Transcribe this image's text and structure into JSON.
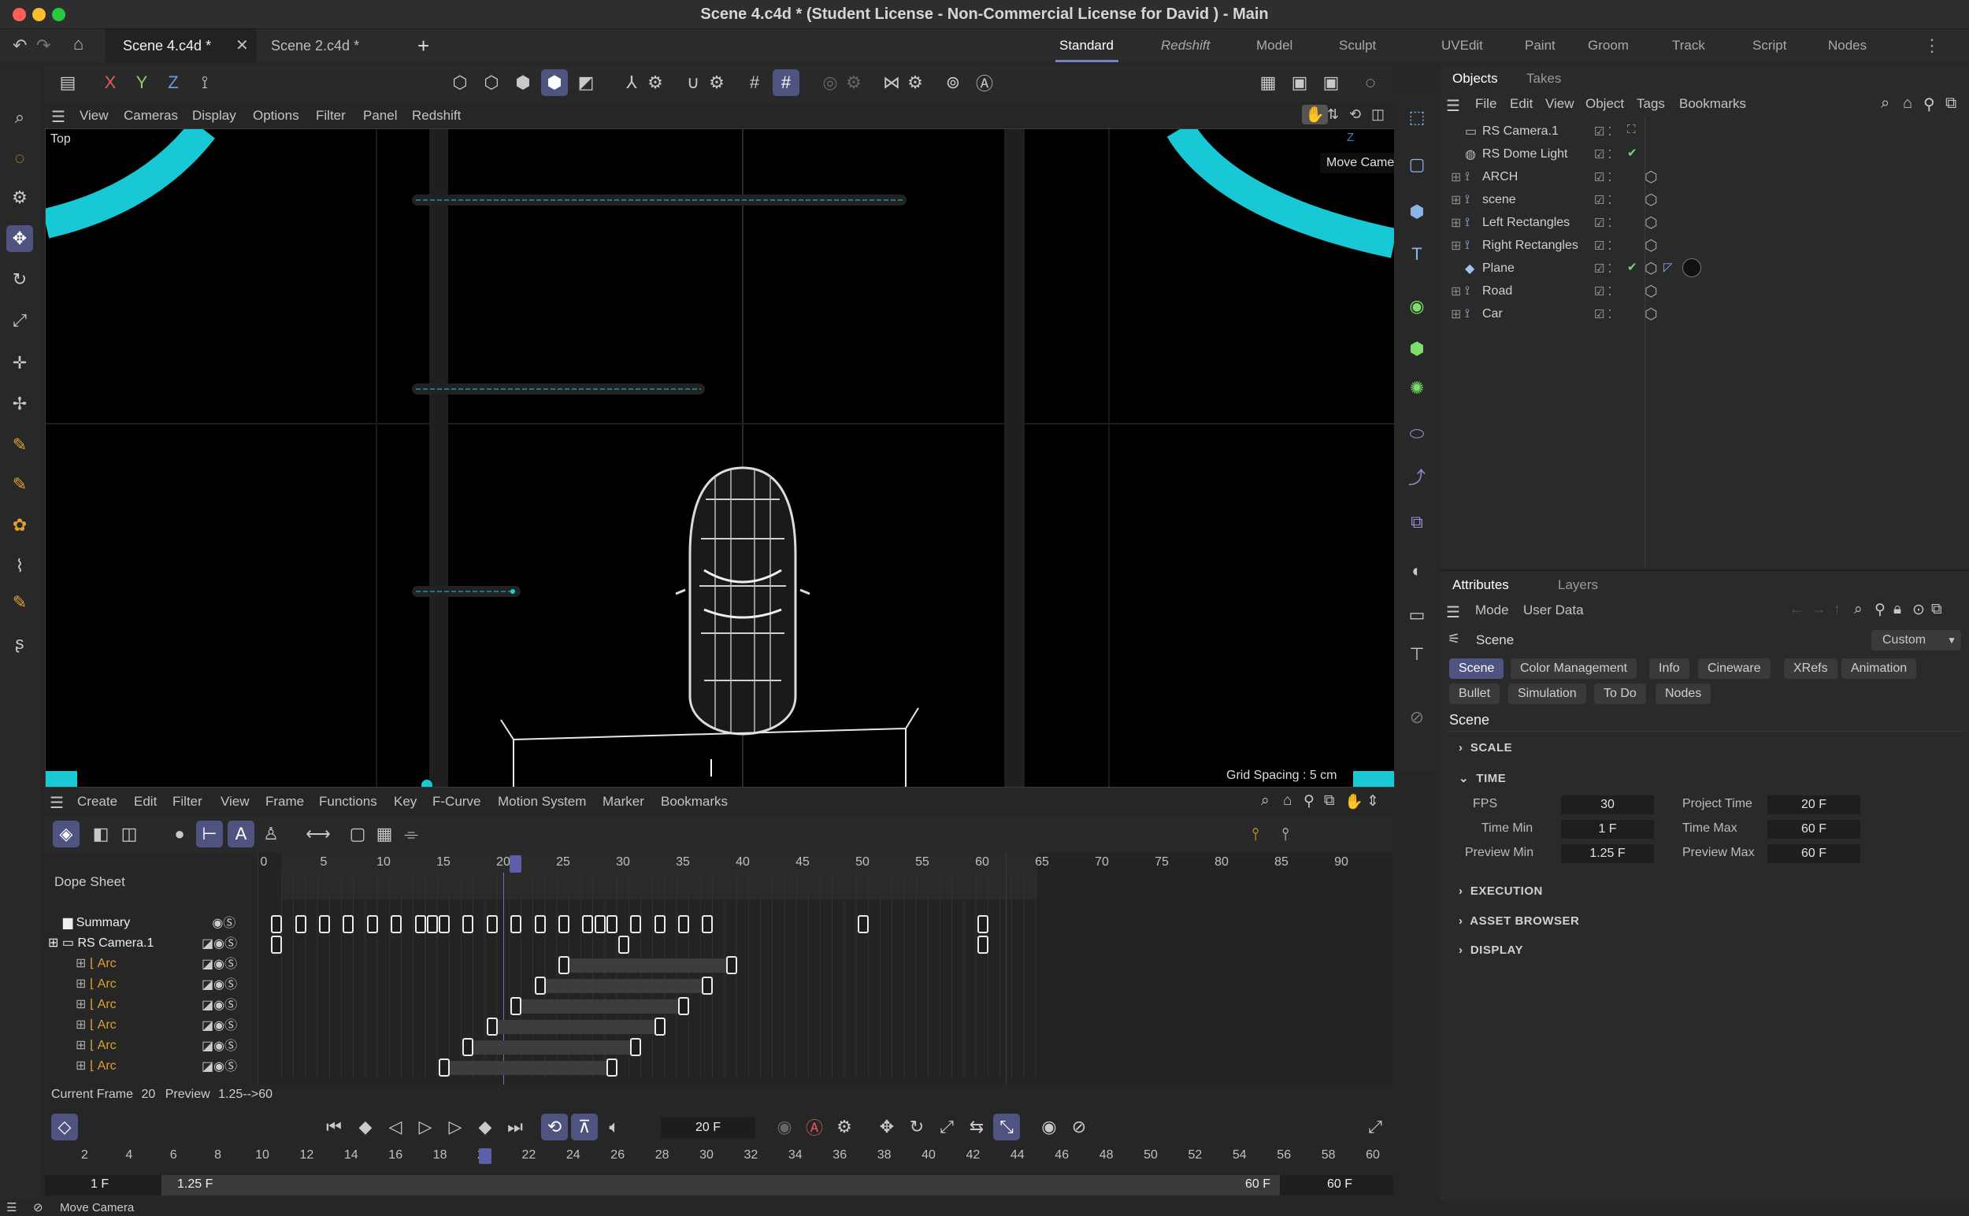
{
  "window": {
    "title": "Scene 4.c4d * (Student License - Non-Commercial License for David ) - Main"
  },
  "doc_tabs": [
    "Scene 4.c4d *",
    "Scene 2.c4d *"
  ],
  "layouts": [
    "Standard",
    "Redshift",
    "Model",
    "Sculpt",
    "UVEdit",
    "Paint",
    "Groom",
    "Track",
    "Script",
    "Nodes"
  ],
  "axes": {
    "x": "X",
    "y": "Y",
    "z": "Z"
  },
  "viewport": {
    "menu": [
      "View",
      "Cameras",
      "Display",
      "Options",
      "Filter",
      "Panel",
      "Redshift"
    ],
    "label": "Top",
    "grid_spacing": "Grid Spacing : 5 cm",
    "axis_z": "Z",
    "tooltip": "Move Camera"
  },
  "objects_panel": {
    "tabs": [
      "Objects",
      "Takes"
    ],
    "menu": [
      "File",
      "Edit",
      "View",
      "Object",
      "Tags",
      "Bookmarks"
    ],
    "items": [
      {
        "name": "RS Camera.1",
        "icon": "camera-icon"
      },
      {
        "name": "RS Dome Light",
        "icon": "light-icon"
      },
      {
        "name": "ARCH",
        "icon": "null-icon"
      },
      {
        "name": "scene",
        "icon": "null-icon"
      },
      {
        "name": "Left Rectangles",
        "icon": "null-icon"
      },
      {
        "name": "Right Rectangles",
        "icon": "null-icon"
      },
      {
        "name": "Plane",
        "icon": "plane-icon"
      },
      {
        "name": "Road",
        "icon": "null-icon"
      },
      {
        "name": "Car",
        "icon": "null-icon"
      }
    ]
  },
  "attributes": {
    "tabs": [
      "Attributes",
      "Layers"
    ],
    "menu": [
      "Mode",
      "User Data"
    ],
    "object": "Scene",
    "preset": "Custom",
    "pages_row1": [
      "Scene",
      "Color Management",
      "Info",
      "Cineware",
      "XRefs",
      "Animation"
    ],
    "pages_row2": [
      "Bullet",
      "Simulation",
      "To Do",
      "Nodes"
    ],
    "heading": "Scene",
    "sections": [
      "SCALE",
      "TIME",
      "EXECUTION",
      "ASSET BROWSER",
      "DISPLAY"
    ],
    "fields": {
      "fps_label": "FPS",
      "fps": "30",
      "project_time_label": "Project Time",
      "project_time": "20 F",
      "time_min_label": "Time Min",
      "time_min": "1 F",
      "time_max_label": "Time Max",
      "time_max": "60 F",
      "preview_min_label": "Preview Min",
      "preview_min": "1.25 F",
      "preview_max_label": "Preview Max",
      "preview_max": "60 F"
    }
  },
  "timeline": {
    "menu": [
      "Create",
      "Edit",
      "Filter",
      "View",
      "Frame",
      "Functions",
      "Key",
      "F-Curve",
      "Motion System",
      "Marker",
      "Bookmarks"
    ],
    "mode": "Dope Sheet",
    "ruler": [
      "0",
      "5",
      "10",
      "15",
      "20",
      "25",
      "30",
      "35",
      "40",
      "45",
      "50",
      "55",
      "60",
      "65",
      "70",
      "75",
      "80",
      "85",
      "90"
    ],
    "tracks": [
      {
        "name": "Summary"
      },
      {
        "name": "RS Camera.1"
      },
      {
        "name": "Arc"
      },
      {
        "name": "Arc"
      },
      {
        "name": "Arc"
      },
      {
        "name": "Arc"
      },
      {
        "name": "Arc"
      },
      {
        "name": "Arc"
      }
    ],
    "current_frame_label": "Current Frame",
    "current_frame": "20",
    "preview_label": "Preview",
    "preview_range": "1.25-->60"
  },
  "transport": {
    "frame_field": "20 F",
    "ruler": [
      "2",
      "4",
      "6",
      "8",
      "10",
      "12",
      "14",
      "16",
      "18",
      "20",
      "22",
      "24",
      "26",
      "28",
      "30",
      "32",
      "34",
      "36",
      "38",
      "40",
      "42",
      "44",
      "46",
      "48",
      "50",
      "52",
      "54",
      "56",
      "58",
      "60"
    ],
    "range_start": "1 F",
    "preview_start": "1.25 F",
    "preview_end": "60 F",
    "range_end": "60 F"
  },
  "status": {
    "text": "Move Camera"
  }
}
